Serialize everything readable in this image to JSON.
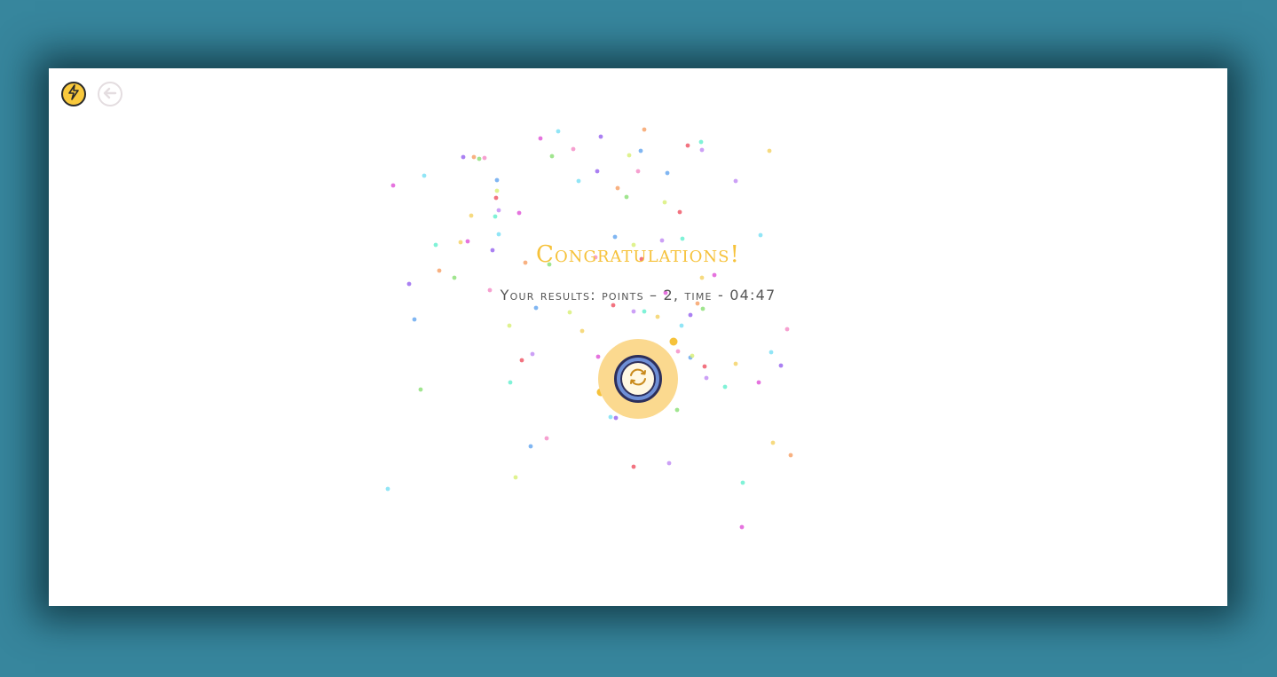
{
  "game": {
    "title": "Congratulations!",
    "results_text": "Your results: points – 2, time - 04:47"
  },
  "toolbar": {
    "hint_icon": "lightning-icon",
    "back_icon": "back-arrow-icon"
  },
  "restart": {
    "icon": "refresh-icon"
  },
  "colors": {
    "background": "#37869d",
    "accent": "#f6c23b",
    "panel": "#ffffff",
    "restart_ring": "#fbd98f",
    "restart_blue": "#6e8fd6"
  },
  "confetti_colors": [
    "#e05ad8",
    "#7ee0f5",
    "#9b6af0",
    "#f7a36b",
    "#8fe07b",
    "#f48fc8",
    "#6aa9f0",
    "#d9f07b",
    "#f05a6a",
    "#c38ff5",
    "#6af0d0",
    "#f5d36a"
  ]
}
